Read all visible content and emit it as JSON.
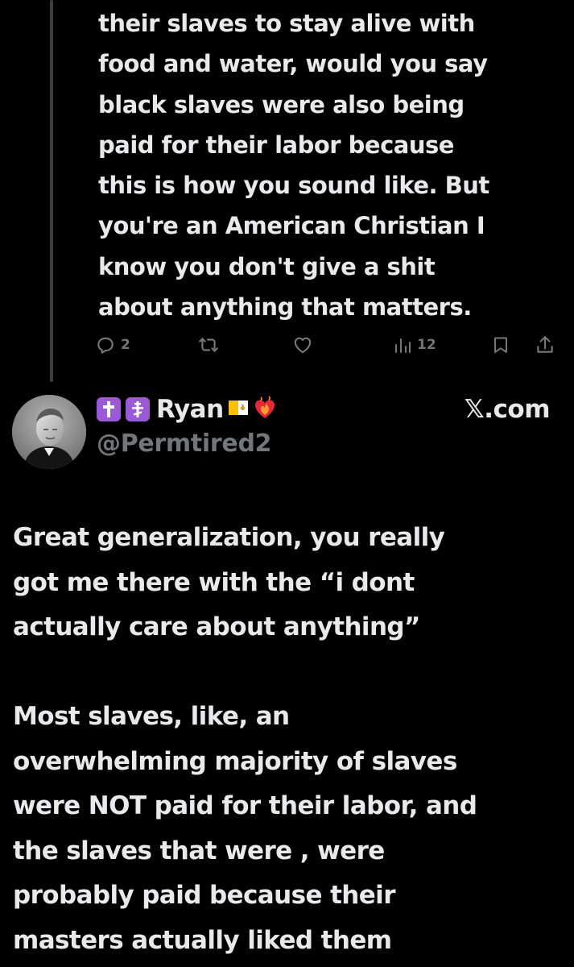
{
  "reply": {
    "text": "their slaves to stay alive with\nfood and water, would you say\nblack slaves were also being\npaid for their labor because\nthis is how you sound like. But\nyou're an American Christian I\nknow you don't give a shit\nabout anything that matters.",
    "reply_count": "2",
    "view_count": "12",
    "icons": {
      "reply": "speech-bubble-icon",
      "repost": "repost-arrows-icon",
      "like": "heart-icon",
      "views": "bar-chart-icon",
      "bookmark": "bookmark-icon",
      "share": "share-upload-icon"
    }
  },
  "post": {
    "display_name": "Ryan",
    "handle": "@Permtired2",
    "source": "𝕏.com",
    "name_badges": [
      "latin-cross-emoji",
      "orthodox-cross-emoji",
      "vatican-flag-emoji",
      "heart-on-fire-emoji"
    ],
    "paragraph_1": "Great generalization, you really\ngot me there with the “i dont\nactually care about anything”",
    "paragraph_2": "Most slaves, like, an\noverwhelming majority of slaves\nwere NOT paid for their labor, and\nthe slaves that were , were\nprobably paid because their\nmasters actually liked them"
  },
  "colors": {
    "background": "#000000",
    "text": "#e7e9ea",
    "muted": "#71767b",
    "thread_line": "#3a3d41",
    "badge_purple": "#9b59d6"
  }
}
